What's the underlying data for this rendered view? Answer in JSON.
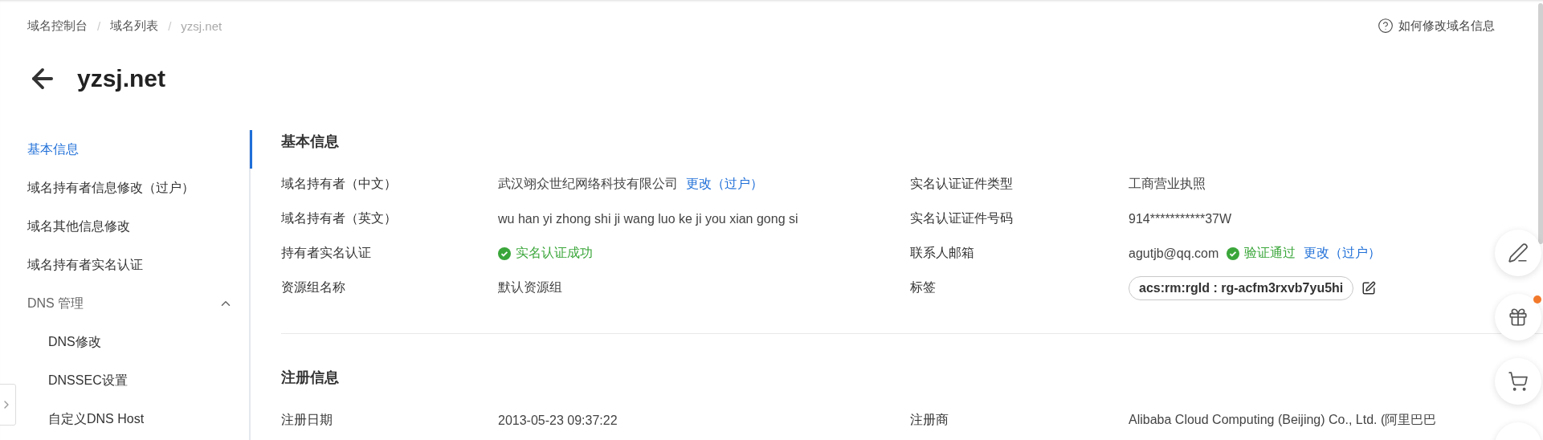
{
  "breadcrumb": [
    {
      "label": "域名控制台",
      "current": false
    },
    {
      "label": "域名列表",
      "current": false
    },
    {
      "label": "yzsj.net",
      "current": true
    }
  ],
  "breadcrumb_separator": "/",
  "help_link": "如何修改域名信息",
  "page_title": "yzsj.net",
  "sidebar": {
    "items": [
      {
        "label": "基本信息",
        "selected": true
      },
      {
        "label": "域名持有者信息修改（过户）",
        "selected": false
      },
      {
        "label": "域名其他信息修改",
        "selected": false
      },
      {
        "label": "域名持有者实名认证",
        "selected": false
      },
      {
        "label": "DNS 管理",
        "selected": false,
        "expanded": true,
        "children": [
          {
            "label": "DNS修改",
            "selected": false
          },
          {
            "label": "DNSSEC设置",
            "selected": false
          },
          {
            "label": "自定义DNS Host",
            "selected": false
          }
        ]
      }
    ]
  },
  "sections": [
    {
      "title": "基本信息",
      "fields": [
        {
          "label": "域名持有者（中文）",
          "kind": "text",
          "value": "武汉翊众世纪网络科技有限公司",
          "link": "更改（过户）"
        },
        {
          "label": "实名认证证件类型",
          "kind": "text",
          "value": "工商营业执照"
        },
        {
          "label": "域名持有者（英文）",
          "kind": "text",
          "value": "wu han yi zhong shi ji wang luo ke ji you xian gong si"
        },
        {
          "label": "实名认证证件号码",
          "kind": "text",
          "value": "914***********37W"
        },
        {
          "label": "持有者实名认证",
          "kind": "status",
          "status": "实名认证成功"
        },
        {
          "label": "联系人邮箱",
          "kind": "text",
          "value": "agutjb@qq.com",
          "status": "验证通过",
          "link": "更改（过户）"
        },
        {
          "label": "资源组名称",
          "kind": "text",
          "value": "默认资源组"
        },
        {
          "label": "标签",
          "kind": "tag",
          "value": "acs:rm:rgId : rg-acfm3rxvb7yu5hi"
        }
      ]
    },
    {
      "title": "注册信息",
      "fields": [
        {
          "label": "注册日期",
          "kind": "text",
          "value": "2013-05-23 09:37:22"
        },
        {
          "label": "注册商",
          "kind": "text",
          "value": "Alibaba Cloud Computing (Beijing) Co., Ltd. (阿里巴巴"
        }
      ]
    }
  ],
  "floating_buttons": [
    {
      "kind": "edit",
      "dot": false
    },
    {
      "kind": "gift",
      "dot": true
    },
    {
      "kind": "cart",
      "dot": false
    },
    {
      "kind": "other",
      "dot": false
    }
  ]
}
